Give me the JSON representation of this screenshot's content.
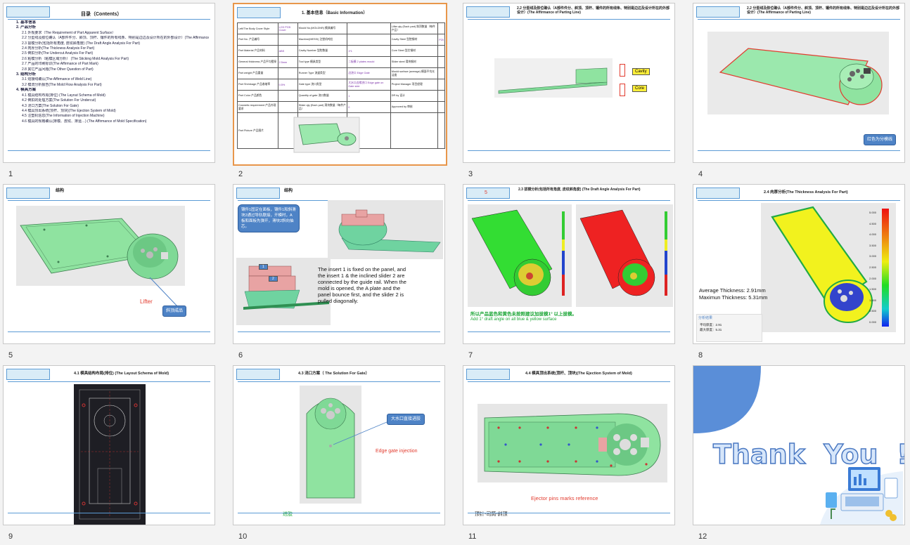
{
  "slides": [
    {
      "number": "1",
      "title": "目录（Contents）",
      "toc": [
        {
          "level": 1,
          "text": "1. 基本信息"
        },
        {
          "level": 1,
          "text": "2. 产品分析"
        },
        {
          "level": 2,
          "text": "2.1 外观要求（The Requirement of Part Apparent Surface）"
        },
        {
          "level": 2,
          "text": "2.2 分型线及胶位确认（A部件件分、斜顶、顶杆、镶件的所有线条、特别是边边及设计所在的外部设计）(The Affirmance of Parting Line)"
        },
        {
          "level": 2,
          "text": "2.3 拔模分析(包括所有角度, 皮纹斜角度) (The Draft Angle Analysis For Part)"
        },
        {
          "level": 2,
          "text": "2.4 肉厚分析(The Thickness Analysis For Part)"
        },
        {
          "level": 2,
          "text": "2.5 倒扣分析(The Undercut Analysis For Part)"
        },
        {
          "level": 2,
          "text": "2.6 粘模分析（粘模区域分析） (The Sticking Mold Analysis For Part)"
        },
        {
          "level": 2,
          "text": "2.7 产品的印刷标识(The Affirmance of Part Mark)"
        },
        {
          "level": 2,
          "text": "2.8 其它产品问题(The Other Question of Part)"
        },
        {
          "level": 1,
          "text": "3. 结构分析"
        },
        {
          "level": 2,
          "text": "3.1 熔接线确认(The Affirmance of Weld Line)"
        },
        {
          "level": 2,
          "text": "3.2 模流分析报告(The Mold Flow Analysis For Part)"
        },
        {
          "level": 1,
          "text": "4. 模具方案"
        },
        {
          "level": 2,
          "text": "4.1 模具结构布局(排位) (The Layout Schema of Mold)"
        },
        {
          "level": 2,
          "text": "4.2 倒扣的处理方案(The Solution For Undercut)"
        },
        {
          "level": 2,
          "text": "4.3 浇口方案(The Solution For Gate)"
        },
        {
          "level": 2,
          "text": "4.4 模具顶出系统(顶杆、顶块)(The Ejection System of Mold)"
        },
        {
          "level": 2,
          "text": "4.5 注塑机信息(The Information of Injection Machine)"
        },
        {
          "level": 2,
          "text": "4.6 模具的规格确认(排模、皮纹、排运…) (The Affirmance of Mold Specification)"
        }
      ]
    },
    {
      "number": "2",
      "title": "1. 基本信息（Basic Information）",
      "cells": {
        "r1": [
          "Left/The Body Cover Style",
          "LCD PCB Cover",
          "Mould No.(MOLDNR) 模具编号",
          "",
          "Lifter qty (Each part) 斜顶数量（每件产品）",
          ""
        ],
        "r2": [
          "Part No. 产品编号",
          "",
          "Machine(MESSI) 注塑机吨位",
          "",
          "Cavity Steel 型腔钢材",
          "P20"
        ],
        "r3": [
          "Part Material 产品材料",
          "ABS",
          "Cavity Number 型腔数量",
          "1*1",
          "Core Steel 型芯钢材",
          ""
        ],
        "r4": [
          "General thickness 产品平均壁厚",
          "2.5mm",
          "Tool type 模具类型",
          "二板模 2 plates mould",
          "Slider steel 滑块钢材",
          ""
        ],
        "r5": [
          "Part weight 产品重量",
          "",
          "Runner Type 流道类型",
          "边浇口 Edge Gate",
          "Mould surface (average) 模面平均光洁度",
          ""
        ],
        "r6": [
          "Part Shrinkage 产品收缩率",
          "0.5%",
          "Gate type 浇口类型",
          "大水口边缘浇口 Edge gate on Gate side",
          "Project Manager 项目经理",
          ""
        ],
        "r7": [
          "Part Color 产品颜色",
          "",
          "Quantity of gate 浇口数量",
          "1",
          "DR by 设计",
          ""
        ],
        "r8": [
          "Cosmetic requirement 产品外观要求",
          "",
          "Slider qty (Each part) 滑块数量（每件产品）",
          "0",
          "Approved by 审核",
          ""
        ],
        "r9": [
          "Part Picture 产品图片",
          "",
          "",
          "",
          "",
          ""
        ]
      }
    },
    {
      "number": "3",
      "title": "2.2 分型线及胶位确认（A部件件分、斜顶、顶杆、镶件的所有线条、特别是边边及设计所在的外部设计）(The Affirmance of Parting Line)",
      "cavity_label": "Cavity",
      "core_label": "Core"
    },
    {
      "number": "4",
      "title": "2.2 分型线及胶位确认（A部件件分、斜顶、顶杆、镶件的所有线条、特别是边边及设计所在的外部设计）(The Affirmance of Parting Line)",
      "note": "红色为分模线"
    },
    {
      "number": "5",
      "title": "结构",
      "lifter_label": "Lifter",
      "callout": "斜顶成品"
    },
    {
      "number": "6",
      "title": "结构",
      "callout": "镶件1固定在面板，镶件1和斜滑块2通过导轨联接，开模时，A板和面板先弹开，滑块2斜向抽芯。",
      "label1": "1",
      "label2": "2",
      "description": "The insert 1 is fixed on the panel, and the insert 1 & the inclined slider 2 are connected by the guide rail. When the mold is opened, the A plate and the panel bounce first, and the slider 2 is pulled diagonally."
    },
    {
      "number": "7",
      "title": "2.3 拔模分析(包括所有角度, 皮纹斜角度) (The Draft Angle Analysis For Part)",
      "tag": "5",
      "note_cn": "所以产品蓝色和黄色未按照建议加拔模1° 以上拔模。",
      "note_en": "Add 1° draft angle on all blue & yellow surface"
    },
    {
      "number": "8",
      "title": "2.4 肉厚分析(The Thickness Analysis For Part)",
      "avg": "Average Thickness: 2.91mm",
      "max": "Maximun Thickness: 5.31mm",
      "panel_title": "分析结果",
      "panel_avg": "平均厚度：2.91",
      "panel_max": "最大厚度：5.31",
      "scale": [
        "5.000",
        "4.500",
        "4.000",
        "3.500",
        "3.000",
        "2.500",
        "2.000",
        "1.500",
        "1.000",
        "0.500",
        "0.000"
      ]
    },
    {
      "number": "9",
      "title": "4.1 模具结构布局(排位) (The Layout Schema of Mold)"
    },
    {
      "number": "10",
      "title": "4.3 浇口方案（ The Solution For Gate）",
      "callout": "大水口直接进胶",
      "gate_label": "Edge gate injection",
      "footer_note": "进胶"
    },
    {
      "number": "11",
      "title": "4.4 模具顶出系统(顶杆、顶块)(The Ejection System of Mold)",
      "ejector_label": "Ejector pins marks reference",
      "footer_note": "顶针-司筒-斜顶"
    },
    {
      "number": "12",
      "thank_you": "Thank  You  !"
    }
  ],
  "colors": {
    "accent": "#5b9bd5",
    "selected_border": "#e8964a",
    "part_green": "#8fe3a0",
    "callout_blue": "#4e83c6"
  }
}
